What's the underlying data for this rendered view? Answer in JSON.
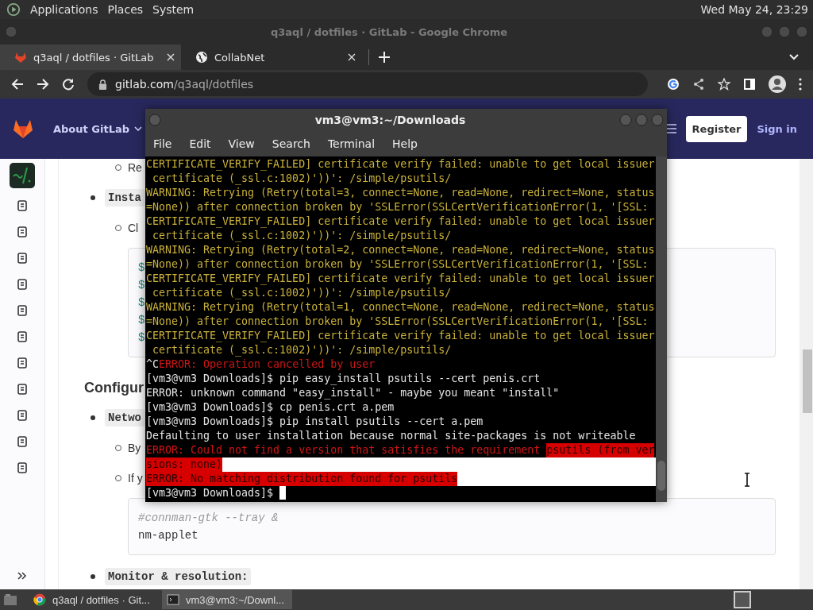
{
  "top_panel": {
    "menus": [
      "Applications",
      "Places",
      "System"
    ],
    "clock": "Wed May 24, 23:29"
  },
  "browser": {
    "title": "q3aql / dotfiles · GitLab - Google Chrome",
    "tabs": [
      {
        "label": "q3aql / dotfiles · GitLab",
        "selected": true,
        "kind": "gitlab"
      },
      {
        "label": "CollabNet",
        "selected": false,
        "kind": "globe"
      }
    ],
    "url_host": "gitlab.com",
    "url_path": "/q3aql/dotfiles"
  },
  "gitlab": {
    "nav_menu": "About GitLab",
    "register": "Register",
    "sign_in": "Sign in",
    "content": [
      {
        "kind": "sub",
        "text": "Re"
      },
      {
        "kind": "bullet_code",
        "text": "Insta"
      },
      {
        "kind": "sub",
        "text": "Cl"
      },
      {
        "kind": "code",
        "lines": [
          {
            "kind": "prompt",
            "text": "$"
          },
          {
            "kind": "prompt",
            "text": "$"
          },
          {
            "kind": "prompt",
            "text": "$"
          },
          {
            "kind": "prompt",
            "text": "$"
          },
          {
            "kind": "prompt",
            "text": "$"
          }
        ]
      },
      {
        "kind": "heading",
        "text": "Configur"
      },
      {
        "kind": "bullet_code",
        "text": "Netwo"
      },
      {
        "kind": "sub",
        "text": "By"
      },
      {
        "kind": "sub",
        "text": "If y"
      },
      {
        "kind": "code",
        "lines": [
          {
            "kind": "comment",
            "text": "#connman-gtk --tray &"
          },
          {
            "kind": "plain",
            "text": "nm-applet"
          }
        ]
      },
      {
        "kind": "bullet_code",
        "text": "Monitor & resolution:"
      }
    ]
  },
  "terminal": {
    "title": "vm3@vm3:~/Downloads",
    "menus": [
      "File",
      "Edit",
      "View",
      "Search",
      "Terminal",
      "Help"
    ],
    "lines": [
      {
        "segments": [
          {
            "kind": "warning",
            "selected": false,
            "text": "CERTIFICATE_VERIFY_FAILED] certificate verify failed: unable to get local issuer"
          }
        ],
        "selection_tail": false,
        "cursor": false
      },
      {
        "segments": [
          {
            "kind": "warning",
            "selected": false,
            "text": " certificate (_ssl.c:1002)'))': /simple/psutils/"
          }
        ],
        "selection_tail": false,
        "cursor": false
      },
      {
        "segments": [
          {
            "kind": "warning",
            "selected": false,
            "text": "WARNING: Retrying (Retry(total=3, connect=None, read=None, redirect=None, status"
          }
        ],
        "selection_tail": false,
        "cursor": false
      },
      {
        "segments": [
          {
            "kind": "warning",
            "selected": false,
            "text": "=None)) after connection broken by 'SSLError(SSLCertVerificationError(1, '[SSL:"
          }
        ],
        "selection_tail": false,
        "cursor": false
      },
      {
        "segments": [
          {
            "kind": "warning",
            "selected": false,
            "text": "CERTIFICATE_VERIFY_FAILED] certificate verify failed: unable to get local issuer"
          }
        ],
        "selection_tail": false,
        "cursor": false
      },
      {
        "segments": [
          {
            "kind": "warning",
            "selected": false,
            "text": " certificate (_ssl.c:1002)'))': /simple/psutils/"
          }
        ],
        "selection_tail": false,
        "cursor": false
      },
      {
        "segments": [
          {
            "kind": "warning",
            "selected": false,
            "text": "WARNING: Retrying (Retry(total=2, connect=None, read=None, redirect=None, status"
          }
        ],
        "selection_tail": false,
        "cursor": false
      },
      {
        "segments": [
          {
            "kind": "warning",
            "selected": false,
            "text": "=None)) after connection broken by 'SSLError(SSLCertVerificationError(1, '[SSL:"
          }
        ],
        "selection_tail": false,
        "cursor": false
      },
      {
        "segments": [
          {
            "kind": "warning",
            "selected": false,
            "text": "CERTIFICATE_VERIFY_FAILED] certificate verify failed: unable to get local issuer"
          }
        ],
        "selection_tail": false,
        "cursor": false
      },
      {
        "segments": [
          {
            "kind": "warning",
            "selected": false,
            "text": " certificate (_ssl.c:1002)'))': /simple/psutils/"
          }
        ],
        "selection_tail": false,
        "cursor": false
      },
      {
        "segments": [
          {
            "kind": "warning",
            "selected": false,
            "text": "WARNING: Retrying (Retry(total=1, connect=None, read=None, redirect=None, status"
          }
        ],
        "selection_tail": false,
        "cursor": false
      },
      {
        "segments": [
          {
            "kind": "warning",
            "selected": false,
            "text": "=None)) after connection broken by 'SSLError(SSLCertVerificationError(1, '[SSL:"
          }
        ],
        "selection_tail": false,
        "cursor": false
      },
      {
        "segments": [
          {
            "kind": "warning",
            "selected": false,
            "text": "CERTIFICATE_VERIFY_FAILED] certificate verify failed: unable to get local issuer"
          }
        ],
        "selection_tail": false,
        "cursor": false
      },
      {
        "segments": [
          {
            "kind": "warning",
            "selected": false,
            "text": " certificate (_ssl.c:1002)'))': /simple/psutils/"
          }
        ],
        "selection_tail": false,
        "cursor": false
      },
      {
        "segments": [
          {
            "kind": "plain",
            "selected": false,
            "text": "^C"
          },
          {
            "kind": "error",
            "selected": false,
            "text": "ERROR: Operation cancelled by user"
          }
        ],
        "selection_tail": false,
        "cursor": false
      },
      {
        "segments": [
          {
            "kind": "plain",
            "selected": false,
            "text": "[vm3@vm3 Downloads]$ pip easy_install psutils --cert penis.crt"
          }
        ],
        "selection_tail": false,
        "cursor": false
      },
      {
        "segments": [
          {
            "kind": "plain",
            "selected": false,
            "text": "ERROR: unknown command \"easy_install\" - maybe you meant \"install\""
          }
        ],
        "selection_tail": false,
        "cursor": false
      },
      {
        "segments": [
          {
            "kind": "plain",
            "selected": false,
            "text": "[vm3@vm3 Downloads]$ cp penis.crt a.pem"
          }
        ],
        "selection_tail": false,
        "cursor": false
      },
      {
        "segments": [
          {
            "kind": "plain",
            "selected": false,
            "text": "[vm3@vm3 Downloads]$ pip install psutils --cert a.pem"
          }
        ],
        "selection_tail": false,
        "cursor": false
      },
      {
        "segments": [
          {
            "kind": "plain",
            "selected": false,
            "text": "Defaulting to user installation because normal site-packages is not writeable"
          }
        ],
        "selection_tail": false,
        "cursor": false
      },
      {
        "segments": [
          {
            "kind": "error",
            "selected": false,
            "text": "ERROR: Could not find a version that satisfies the requirement "
          },
          {
            "kind": "error",
            "selected": true,
            "text": "psutils (from ver"
          }
        ],
        "selection_tail": false,
        "cursor": false
      },
      {
        "segments": [
          {
            "kind": "error",
            "selected": true,
            "text": "sions: none)"
          }
        ],
        "selection_tail": true,
        "cursor": false
      },
      {
        "segments": [
          {
            "kind": "error",
            "selected": true,
            "text": "ERROR: No matching distribution found for psutils"
          }
        ],
        "selection_tail": true,
        "cursor": false
      },
      {
        "segments": [
          {
            "kind": "plain",
            "selected": false,
            "text": "[vm3@vm3 Downloads]$ "
          }
        ],
        "selection_tail": false,
        "cursor": true
      }
    ]
  },
  "taskbar": {
    "tasks": [
      {
        "label": "q3aql / dotfiles · Git...",
        "selected": false,
        "kind": "browser"
      },
      {
        "label": "vm3@vm3:~/Downl...",
        "selected": true,
        "kind": "terminal"
      }
    ]
  }
}
